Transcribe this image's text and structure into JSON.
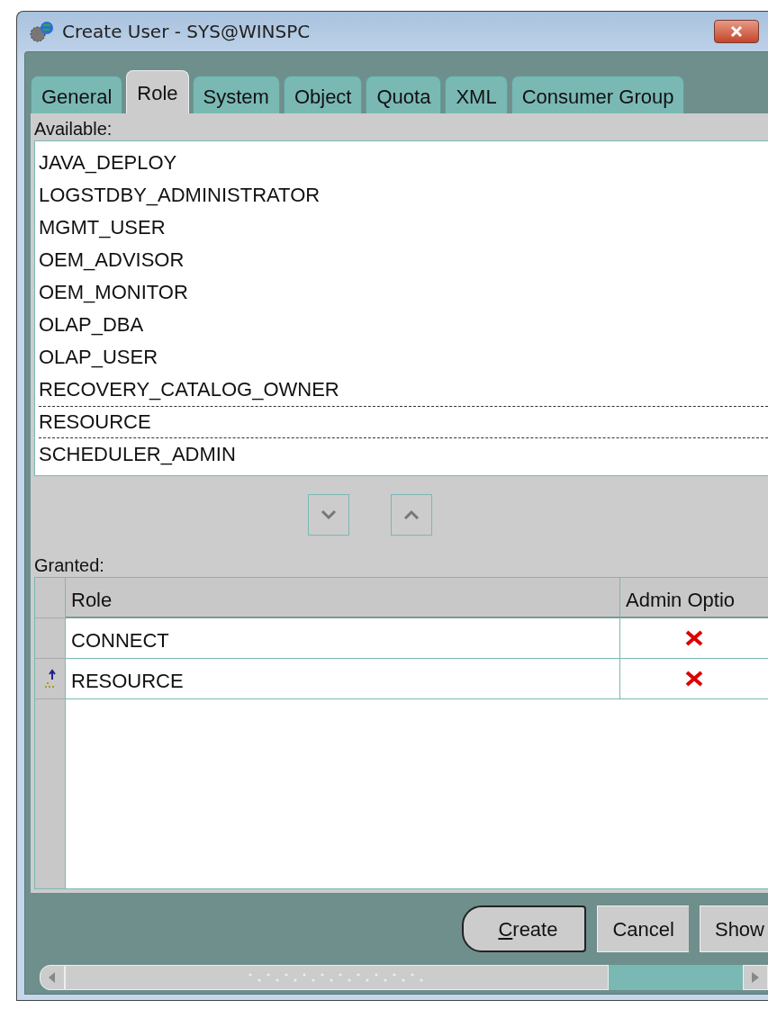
{
  "window": {
    "title": "Create User - SYS@WINSPC"
  },
  "tabs": [
    {
      "label": "General",
      "selected": false
    },
    {
      "label": "Role",
      "selected": true
    },
    {
      "label": "System",
      "selected": false
    },
    {
      "label": "Object",
      "selected": false
    },
    {
      "label": "Quota",
      "selected": false
    },
    {
      "label": "XML",
      "selected": false
    },
    {
      "label": "Consumer Group",
      "selected": false
    }
  ],
  "available": {
    "label": "Available:",
    "items": [
      {
        "name": "JAVA_DEPLOY",
        "focused": false
      },
      {
        "name": "LOGSTDBY_ADMINISTRATOR",
        "focused": false
      },
      {
        "name": "MGMT_USER",
        "focused": false
      },
      {
        "name": "OEM_ADVISOR",
        "focused": false
      },
      {
        "name": "OEM_MONITOR",
        "focused": false
      },
      {
        "name": "OLAP_DBA",
        "focused": false
      },
      {
        "name": "OLAP_USER",
        "focused": false
      },
      {
        "name": "RECOVERY_CATALOG_OWNER",
        "focused": false
      },
      {
        "name": "RESOURCE",
        "focused": true
      },
      {
        "name": "SCHEDULER_ADMIN",
        "focused": false
      }
    ]
  },
  "granted": {
    "label": "Granted:",
    "columns": [
      "Role",
      "Admin Optio"
    ],
    "rows": [
      {
        "role": "CONNECT",
        "admin_option": false,
        "current": false
      },
      {
        "role": "RESOURCE",
        "admin_option": false,
        "current": true
      }
    ]
  },
  "buttons": [
    {
      "label": "Create",
      "default": true,
      "mnemonic_underlined": true
    },
    {
      "label": "Cancel",
      "default": false,
      "mnemonic_underlined": false
    },
    {
      "label": "Show",
      "default": false,
      "mnemonic_underlined": false
    }
  ]
}
